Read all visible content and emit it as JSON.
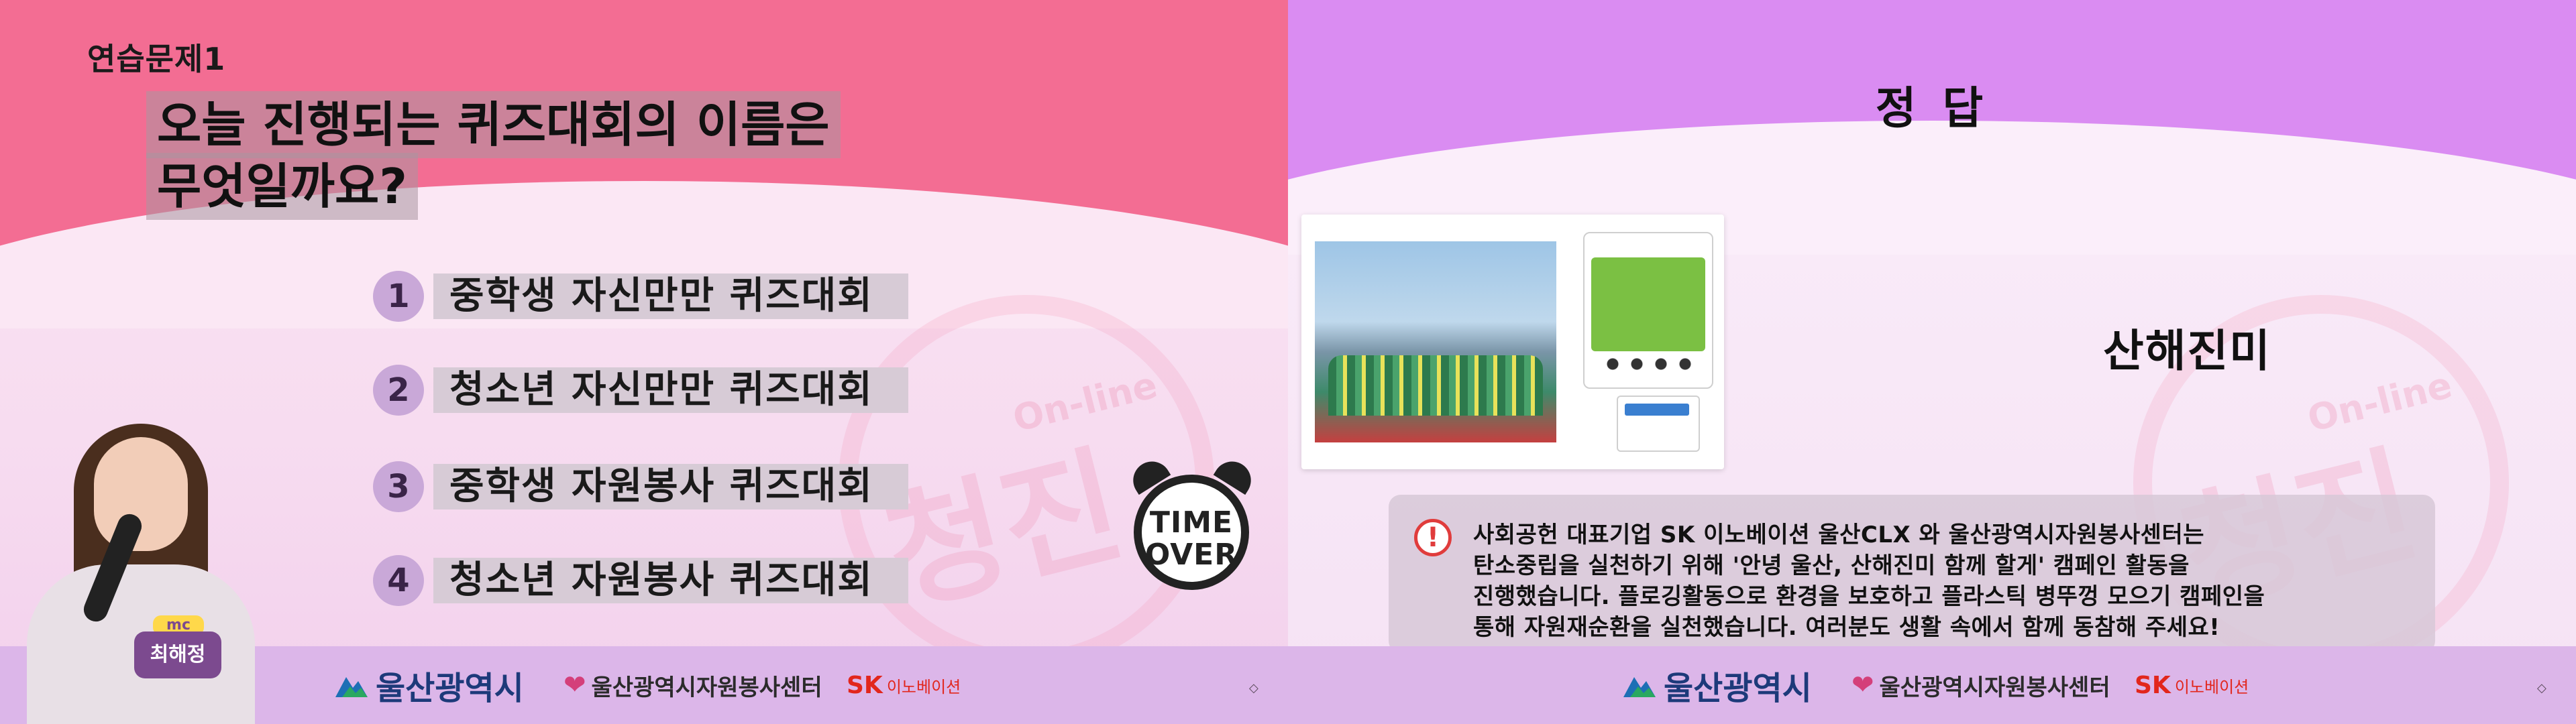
{
  "left": {
    "practice_label": "연습문제1",
    "question_lines": [
      "오늘 진행되는 퀴즈대회의 이름은",
      "무엇일까요?"
    ],
    "options": [
      {
        "num": "1",
        "text": "중학생 자신만만 퀴즈대회"
      },
      {
        "num": "2",
        "text": "청소년 자신만만 퀴즈대회"
      },
      {
        "num": "3",
        "text": "중학생 자원봉사 퀴즈대회"
      },
      {
        "num": "4",
        "text": "청소년 자원봉사 퀴즈대회"
      }
    ],
    "timer": {
      "line1": "TIME",
      "line2": "OVER"
    },
    "presenter": {
      "badge_top": "mc",
      "badge_name": "최해정"
    }
  },
  "right": {
    "title": "정 답",
    "answer": "산해진미",
    "explanation": [
      "사회공헌 대표기업 SK 이노베이션 울산CLX 와 울산광역시자원봉사센터는",
      "탄소중립을 실천하기 위해 '안녕 울산, 산해진미 함께 할게' 캠페인 활동을",
      "진행했습니다. 플로깅활동으로 환경을 보호하고 플라스틱 병뚜껑 모으기 캠페인을",
      "통해 자원재순환을 실천했습니다. 여러분도 생활 속에서 함께 동참해 주세요!"
    ]
  },
  "watermark": {
    "main": "청진",
    "sub": "On-line"
  },
  "footer": {
    "city": "울산광역시",
    "volunteer_center": "울산광역시자원봉사센터",
    "sk": "SK",
    "sk_sub": "이노베이션",
    "page_mark": "◇"
  },
  "colors": {
    "left_band": "#f36d93",
    "right_band": "#da8cf2",
    "footer": "#dcb6e9",
    "option_num": "#c9a8d8",
    "alert": "#e03c3c"
  }
}
